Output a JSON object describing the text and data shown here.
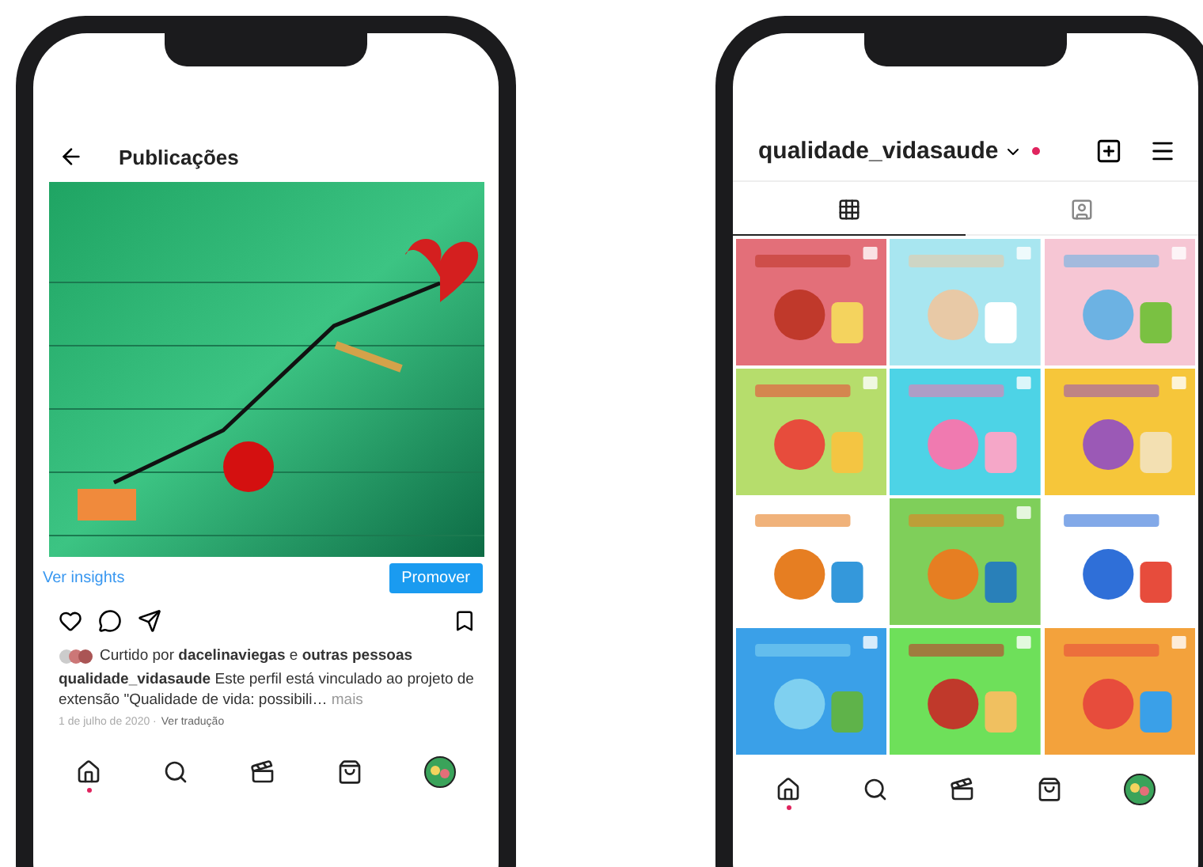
{
  "post_screen": {
    "title": "Publicações",
    "insights_link": "Ver insights",
    "promote_button": "Promover",
    "likes": "Curtido por **dacelinaviegas** e **outras pessoas**",
    "caption": "**qualidade_vidasaude** Este perfil está vinculado ao projeto de extensão \"Qualidade de vida: possibili…",
    "more_link": "mais",
    "date": "1 de julho de 2020 ·",
    "translate_link": "Ver tradução",
    "nav": [
      {
        "kind": "home",
        "badge": true
      },
      {
        "kind": "search",
        "badge": false
      },
      {
        "kind": "reels",
        "badge": false
      },
      {
        "kind": "shop",
        "badge": false
      },
      {
        "kind": "profile",
        "badge": false
      }
    ]
  },
  "profile_screen": {
    "username": "qualidade_vidasaude",
    "account_badge": true,
    "tabs": [
      {
        "kind": "grid",
        "selected": true
      },
      {
        "kind": "tagged",
        "selected": false
      }
    ],
    "nav": [
      {
        "kind": "home",
        "badge": true
      },
      {
        "kind": "search",
        "badge": false
      },
      {
        "kind": "reels",
        "badge": false
      },
      {
        "kind": "shop",
        "badge": false
      },
      {
        "kind": "profile",
        "badge": false
      }
    ]
  }
}
